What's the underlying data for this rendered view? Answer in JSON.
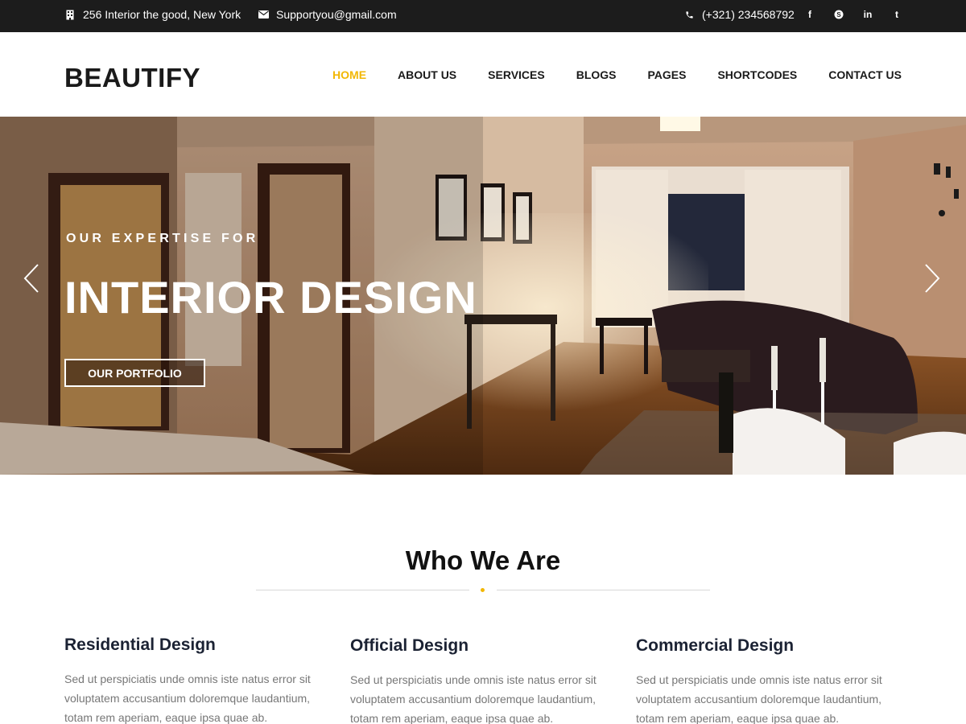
{
  "topbar": {
    "address": "256 Interior the good, New York",
    "email": "Supportyou@gmail.com",
    "phone": "(+321) 234568792",
    "address_icon": "building-icon",
    "email_icon": "envelope-icon",
    "phone_icon": "phone-icon",
    "social": [
      {
        "name": "facebook-icon",
        "glyph": "f"
      },
      {
        "name": "skype-icon",
        "glyph": "S"
      },
      {
        "name": "linkedin-icon",
        "glyph": "in"
      },
      {
        "name": "tumblr-icon",
        "glyph": "t"
      }
    ]
  },
  "header": {
    "logo": "BEAUTIFY",
    "nav": [
      {
        "label": "HOME",
        "active": true
      },
      {
        "label": "ABOUT US",
        "active": false
      },
      {
        "label": "SERVICES",
        "active": false
      },
      {
        "label": "BLOGS",
        "active": false
      },
      {
        "label": "PAGES",
        "active": false
      },
      {
        "label": "SHORTCODES",
        "active": false
      },
      {
        "label": "CONTACT US",
        "active": false
      }
    ]
  },
  "hero": {
    "kicker": "OUR EXPERTISE FOR",
    "title": "INTERIOR DESIGN",
    "cta": "OUR PORTFOLIO",
    "prev_icon": "chevron-left-icon",
    "next_icon": "chevron-right-icon"
  },
  "section": {
    "title": "Who We Are",
    "cards": [
      {
        "title": "Residential Design",
        "text": "Sed ut perspiciatis unde omnis iste natus error sit voluptatem accusantium doloremque laudantium, totam rem aperiam, eaque ipsa quae ab."
      },
      {
        "title": "Official Design",
        "text": "Sed ut perspiciatis unde omnis iste natus error sit voluptatem accusantium doloremque laudantium, totam rem aperiam, eaque ipsa quae ab."
      },
      {
        "title": "Commercial Design",
        "text": "Sed ut perspiciatis unde omnis iste natus error sit voluptatem accusantium doloremque laudantium, totam rem aperiam, eaque ipsa quae ab."
      }
    ]
  },
  "colors": {
    "accent": "#f2b705",
    "topbar_bg": "#1c1c1c",
    "heading": "#1b2233",
    "body_text": "#777777"
  }
}
